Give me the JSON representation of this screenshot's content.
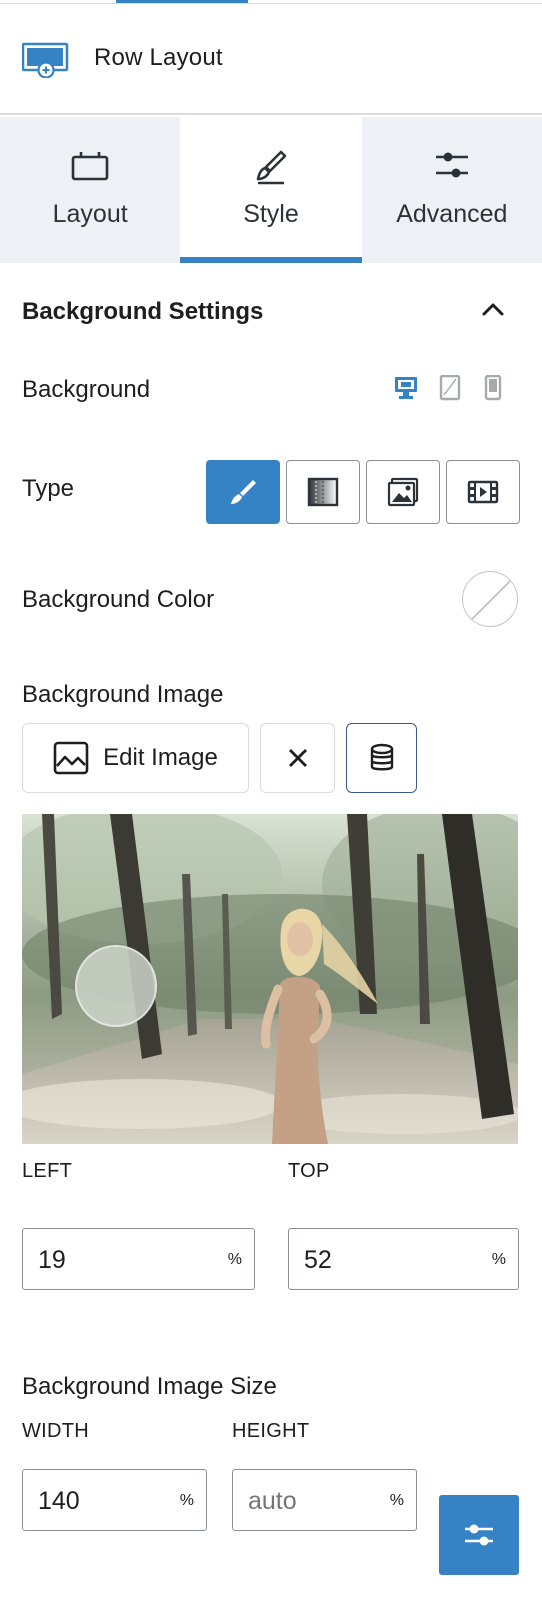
{
  "header": {
    "title": "Row Layout",
    "icon": "row-layout-icon"
  },
  "tabs": [
    {
      "label": "Layout",
      "icon": "layout-icon",
      "active": false
    },
    {
      "label": "Style",
      "icon": "brush-icon",
      "active": true
    },
    {
      "label": "Advanced",
      "icon": "sliders-icon",
      "active": false
    }
  ],
  "background_settings": {
    "title": "Background Settings",
    "background_label": "Background",
    "devices": [
      "desktop-icon",
      "tablet-icon",
      "mobile-icon"
    ],
    "active_device": "desktop",
    "type_label": "Type",
    "types": [
      "brush-icon",
      "gradient-icon",
      "image-icon",
      "video-icon"
    ],
    "active_type": "classic",
    "color_label": "Background Color",
    "color_value": "none",
    "image_label": "Background Image",
    "edit_image_label": "Edit Image"
  },
  "focal_point": {
    "left_label": "LEFT",
    "left_value": "19",
    "left_unit": "%",
    "top_label": "TOP",
    "top_value": "52",
    "top_unit": "%"
  },
  "image_size": {
    "label": "Background Image Size",
    "width_label": "WIDTH",
    "width_value": "140",
    "width_unit": "%",
    "height_label": "HEIGHT",
    "height_placeholder": "auto",
    "height_unit": "%"
  },
  "colors": {
    "accent": "#3582c4",
    "tab_bg": "#edf0f5",
    "border": "#8c8f94"
  }
}
